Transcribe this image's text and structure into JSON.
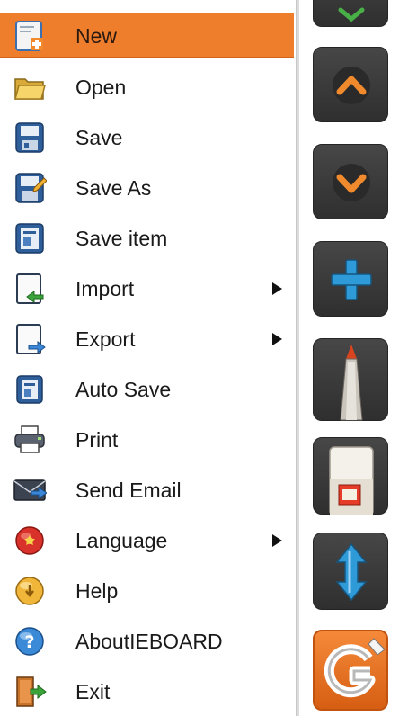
{
  "menu": {
    "items": [
      {
        "label": "New",
        "icon": "new-file-icon",
        "selected": true,
        "submenu": false
      },
      {
        "label": "Open",
        "icon": "folder-open-icon",
        "selected": false,
        "submenu": false
      },
      {
        "label": "Save",
        "icon": "save-icon",
        "selected": false,
        "submenu": false
      },
      {
        "label": "Save As",
        "icon": "save-as-icon",
        "selected": false,
        "submenu": false
      },
      {
        "label": "Save item",
        "icon": "save-item-icon",
        "selected": false,
        "submenu": false
      },
      {
        "label": "Import",
        "icon": "import-icon",
        "selected": false,
        "submenu": true
      },
      {
        "label": "Export",
        "icon": "export-icon",
        "selected": false,
        "submenu": true
      },
      {
        "label": "Auto Save",
        "icon": "auto-save-icon",
        "selected": false,
        "submenu": false
      },
      {
        "label": "Print",
        "icon": "printer-icon",
        "selected": false,
        "submenu": false
      },
      {
        "label": "Send Email",
        "icon": "email-icon",
        "selected": false,
        "submenu": false
      },
      {
        "label": "Language",
        "icon": "language-icon",
        "selected": false,
        "submenu": true
      },
      {
        "label": "Help",
        "icon": "help-icon",
        "selected": false,
        "submenu": false
      },
      {
        "label": "AboutIEBOARD",
        "icon": "about-icon",
        "selected": false,
        "submenu": false
      },
      {
        "label": "Exit",
        "icon": "exit-door-icon",
        "selected": false,
        "submenu": false
      }
    ]
  },
  "toolbar": {
    "buttons": [
      {
        "icon": "chevron-up-icon"
      },
      {
        "icon": "chevron-down-icon"
      },
      {
        "icon": "plus-icon"
      },
      {
        "icon": "pen-icon"
      },
      {
        "icon": "eraser-icon"
      },
      {
        "icon": "resize-vertical-icon"
      },
      {
        "icon": "app-logo-icon"
      }
    ]
  },
  "colors": {
    "selection": "#ee7d2c",
    "toolbar_button": "#3c3c3c",
    "accent_orange": "#f08a2c",
    "accent_blue": "#2f9ad8"
  }
}
